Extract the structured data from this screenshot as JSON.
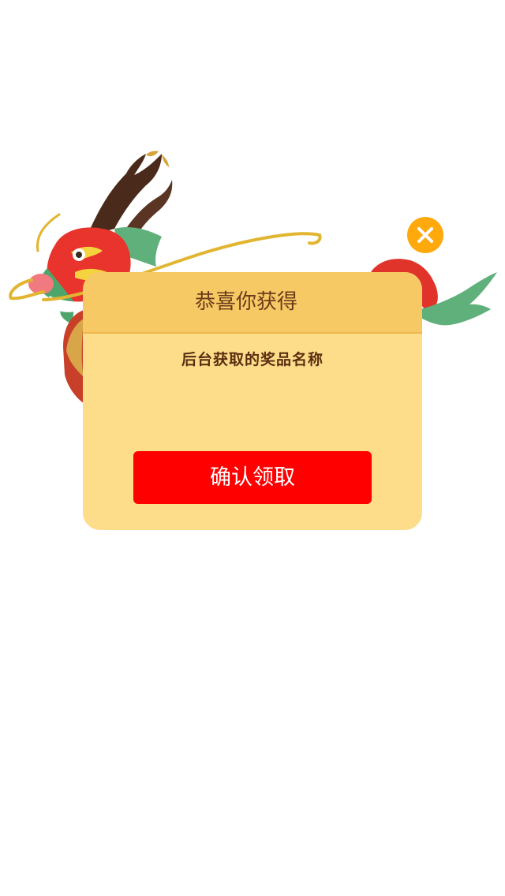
{
  "dialog": {
    "title": "恭喜你获得",
    "prize_name": "后台获取的奖品名称",
    "confirm_label": "确认领取"
  },
  "colors": {
    "dialog_background": "#FDDD8A",
    "header_background": "#F6C965",
    "confirm_button": "#FF0000",
    "close_button": "#FFA90C",
    "title_text": "#6B3A1B"
  },
  "icons": {
    "close": "close-icon",
    "decoration": "dragon-illustration"
  }
}
